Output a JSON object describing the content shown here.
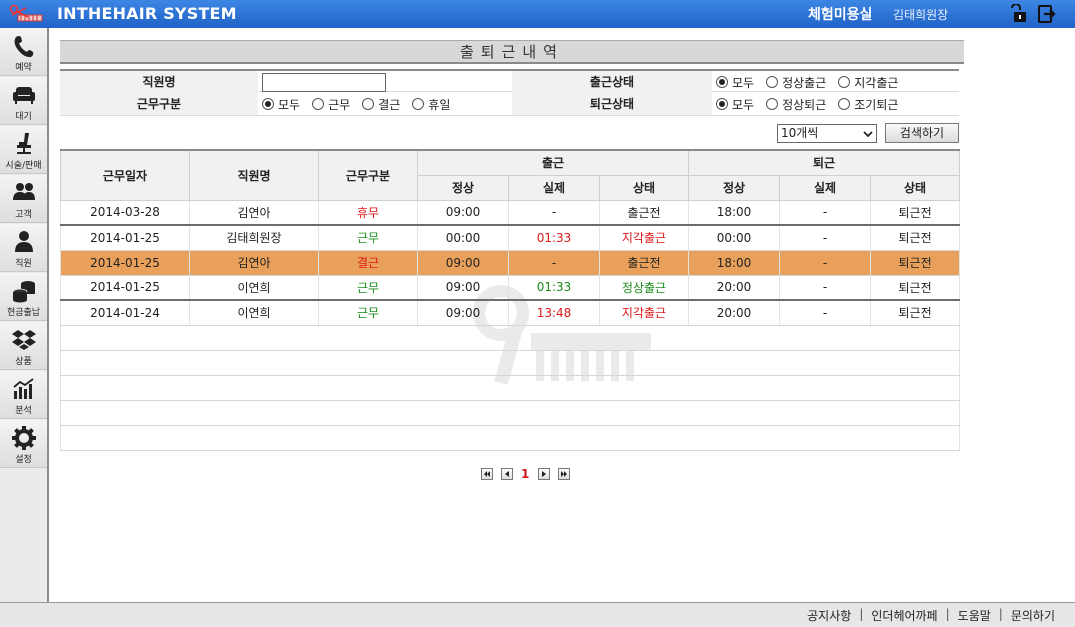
{
  "header": {
    "app_title": "INTHEHAIR SYSTEM",
    "salon_name": "체험미용실",
    "user_name": "김태희원장",
    "icons": [
      "scissors-comb-logo",
      "unlock-icon",
      "logout-icon"
    ]
  },
  "sidebar": {
    "items": [
      {
        "label": "예약",
        "icon": "phone-icon"
      },
      {
        "label": "대기",
        "icon": "sofa-icon"
      },
      {
        "label": "시술/판매",
        "icon": "salon-chair-icon"
      },
      {
        "label": "고객",
        "icon": "customers-icon"
      },
      {
        "label": "직원",
        "icon": "staff-icon"
      },
      {
        "label": "현금출납",
        "icon": "coins-icon"
      },
      {
        "label": "상품",
        "icon": "dropbox-icon"
      },
      {
        "label": "분석",
        "icon": "analytics-icon"
      },
      {
        "label": "설정",
        "icon": "gear-icon"
      }
    ]
  },
  "page": {
    "title": "출퇴근내역"
  },
  "filter": {
    "employee_name_label": "직원명",
    "employee_name_value": "",
    "checkin_status_label": "출근상태",
    "checkin_options": [
      "모두",
      "정상출근",
      "지각출근"
    ],
    "checkin_selected": "모두",
    "work_type_label": "근무구분",
    "work_type_options": [
      "모두",
      "근무",
      "결근",
      "휴일"
    ],
    "work_type_selected": "모두",
    "checkout_status_label": "퇴근상태",
    "checkout_options": [
      "모두",
      "정상퇴근",
      "조기퇴근"
    ],
    "checkout_selected": "모두",
    "page_size": "10개씩",
    "search_label": "검색하기"
  },
  "table": {
    "headers": {
      "date": "근무일자",
      "name": "직원명",
      "work_type": "근무구분",
      "checkin": "출근",
      "checkout": "퇴근",
      "scheduled": "정상",
      "actual": "실제",
      "status": "상태"
    },
    "rows": [
      {
        "date": "2014-03-28",
        "name": "김연아",
        "work_type": "휴무",
        "in_sched": "09:00",
        "in_actual": "-",
        "in_status": "출근전",
        "out_sched": "18:00",
        "out_actual": "-",
        "out_status": "퇴근전"
      },
      {
        "date": "2014-01-25",
        "name": "김태희원장",
        "work_type": "근무",
        "in_sched": "00:00",
        "in_actual": "01:33",
        "in_status": "지각출근",
        "out_sched": "00:00",
        "out_actual": "-",
        "out_status": "퇴근전"
      },
      {
        "date": "2014-01-25",
        "name": "김연아",
        "work_type": "결근",
        "in_sched": "09:00",
        "in_actual": "-",
        "in_status": "출근전",
        "out_sched": "18:00",
        "out_actual": "-",
        "out_status": "퇴근전"
      },
      {
        "date": "2014-01-25",
        "name": "이연희",
        "work_type": "근무",
        "in_sched": "09:00",
        "in_actual": "01:33",
        "in_status": "정상출근",
        "out_sched": "20:00",
        "out_actual": "-",
        "out_status": "퇴근전"
      },
      {
        "date": "2014-01-24",
        "name": "이연희",
        "work_type": "근무",
        "in_sched": "09:00",
        "in_actual": "13:48",
        "in_status": "지각출근",
        "out_sched": "20:00",
        "out_actual": "-",
        "out_status": "퇴근전"
      }
    ]
  },
  "pagination": {
    "current_page": "1"
  },
  "footer": {
    "links": [
      "공지사항",
      "인더헤어까페",
      "도움말",
      "문의하기"
    ],
    "separator": "|"
  },
  "colors": {
    "topbar": "#2b73d6",
    "highlight_row": "#e9a05a",
    "late_red": "#e01818",
    "normal_green": "#1a8c1a"
  }
}
